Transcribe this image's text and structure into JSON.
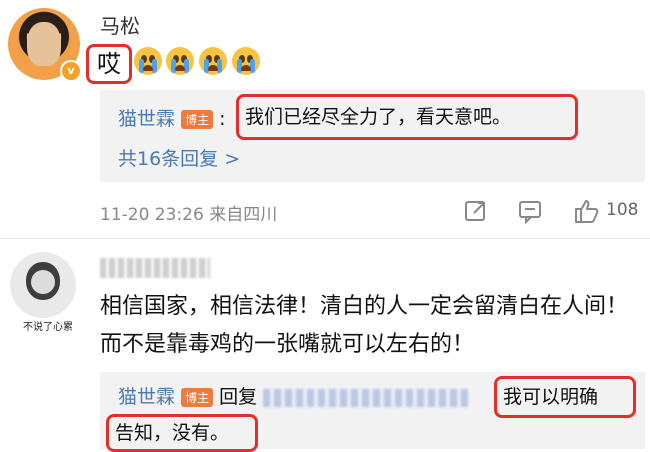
{
  "post": {
    "author": "马松",
    "text": "哎",
    "reply": {
      "author": "猫世霖",
      "badge": "博主",
      "sep": ":",
      "text": "我们已经尽全力了，看天意吧。",
      "more": "共16条回复 >"
    },
    "time": "11-20 23:26 来自四川",
    "likes": "108"
  },
  "comment": {
    "avatar_caption": "不说了心累",
    "text": "相信国家，相信法律！清白的人一定会留清白在人间！而不是靠毒鸡的一张嘴就可以左右的！",
    "reply": {
      "author": "猫世霖",
      "badge": "博主",
      "reply_word": "回复",
      "text_line1": "我可以明确",
      "text_line2": "告知，没有。"
    }
  },
  "colors": {
    "link": "#4a7ab3",
    "highlight": "#e0302a",
    "badge": "#ef7a3d"
  },
  "icons": [
    "verified-badge-icon",
    "crying-emoji-icon",
    "share-icon",
    "comment-icon",
    "like-icon"
  ]
}
